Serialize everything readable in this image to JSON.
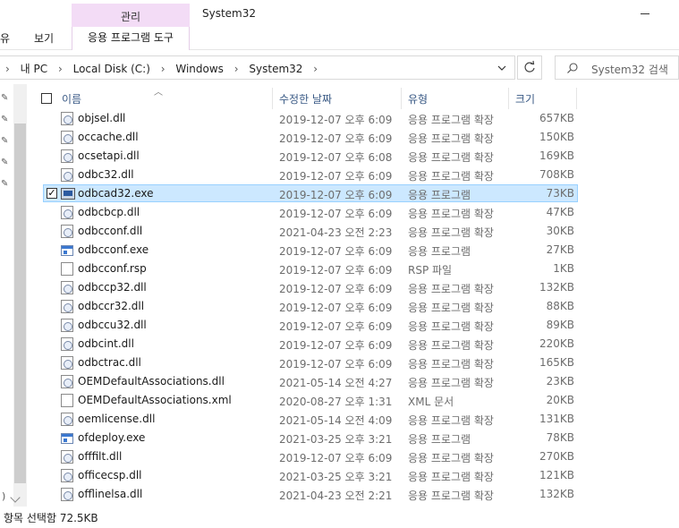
{
  "ribbon": {
    "context_group": "관리",
    "context_tab": "응용 프로그램 도구",
    "tab_partial": "유",
    "tab_view": "보기",
    "window_title": "System32"
  },
  "address": {
    "crumbs": [
      "내 PC",
      "Local Disk (C:)",
      "Windows",
      "System32"
    ],
    "search_placeholder": "System32 검색"
  },
  "columns": {
    "name": "이름",
    "date": "수정한 날짜",
    "type": "유형",
    "size": "크기"
  },
  "files": [
    {
      "name": "objsel.dll",
      "date": "2019-12-07 오후 6:09",
      "type": "응용 프로그램 확장",
      "size": "657KB",
      "icon": "dll-icon"
    },
    {
      "name": "occache.dll",
      "date": "2019-12-07 오후 6:09",
      "type": "응용 프로그램 확장",
      "size": "150KB",
      "icon": "dll-icon"
    },
    {
      "name": "ocsetapi.dll",
      "date": "2019-12-07 오후 6:08",
      "type": "응용 프로그램 확장",
      "size": "169KB",
      "icon": "dll-icon"
    },
    {
      "name": "odbc32.dll",
      "date": "2019-12-07 오후 6:09",
      "type": "응용 프로그램 확장",
      "size": "708KB",
      "icon": "dll-icon"
    },
    {
      "name": "odbcad32.exe",
      "date": "2019-12-07 오후 6:09",
      "type": "응용 프로그램",
      "size": "73KB",
      "icon": "odbc-admin-icon",
      "selected": true
    },
    {
      "name": "odbcbcp.dll",
      "date": "2019-12-07 오후 6:09",
      "type": "응용 프로그램 확장",
      "size": "47KB",
      "icon": "dll-icon"
    },
    {
      "name": "odbcconf.dll",
      "date": "2021-04-23 오전 2:23",
      "type": "응용 프로그램 확장",
      "size": "30KB",
      "icon": "dll-icon"
    },
    {
      "name": "odbcconf.exe",
      "date": "2019-12-07 오후 6:09",
      "type": "응용 프로그램",
      "size": "27KB",
      "icon": "exe-icon"
    },
    {
      "name": "odbcconf.rsp",
      "date": "2019-12-07 오후 6:09",
      "type": "RSP 파일",
      "size": "1KB",
      "icon": "document-icon"
    },
    {
      "name": "odbccp32.dll",
      "date": "2019-12-07 오후 6:09",
      "type": "응용 프로그램 확장",
      "size": "132KB",
      "icon": "dll-icon"
    },
    {
      "name": "odbccr32.dll",
      "date": "2019-12-07 오후 6:09",
      "type": "응용 프로그램 확장",
      "size": "88KB",
      "icon": "dll-icon"
    },
    {
      "name": "odbccu32.dll",
      "date": "2019-12-07 오후 6:09",
      "type": "응용 프로그램 확장",
      "size": "89KB",
      "icon": "dll-icon"
    },
    {
      "name": "odbcint.dll",
      "date": "2019-12-07 오후 6:09",
      "type": "응용 프로그램 확장",
      "size": "220KB",
      "icon": "dll-icon"
    },
    {
      "name": "odbctrac.dll",
      "date": "2019-12-07 오후 6:09",
      "type": "응용 프로그램 확장",
      "size": "165KB",
      "icon": "dll-icon"
    },
    {
      "name": "OEMDefaultAssociations.dll",
      "date": "2021-05-14 오전 4:27",
      "type": "응용 프로그램 확장",
      "size": "23KB",
      "icon": "dll-icon"
    },
    {
      "name": "OEMDefaultAssociations.xml",
      "date": "2020-08-27 오후 1:31",
      "type": "XML 문서",
      "size": "20KB",
      "icon": "document-icon"
    },
    {
      "name": "oemlicense.dll",
      "date": "2021-05-14 오전 4:09",
      "type": "응용 프로그램 확장",
      "size": "131KB",
      "icon": "dll-icon"
    },
    {
      "name": "ofdeploy.exe",
      "date": "2021-03-25 오후 3:21",
      "type": "응용 프로그램",
      "size": "78KB",
      "icon": "exe-icon"
    },
    {
      "name": "offfilt.dll",
      "date": "2019-12-07 오후 6:09",
      "type": "응용 프로그램 확장",
      "size": "270KB",
      "icon": "dll-icon"
    },
    {
      "name": "officecsp.dll",
      "date": "2021-03-25 오후 3:21",
      "type": "응용 프로그램 확장",
      "size": "121KB",
      "icon": "dll-icon"
    },
    {
      "name": "offlinelsa.dll",
      "date": "2021-04-23 오전 2:21",
      "type": "응용 프로그램 확장",
      "size": "132KB",
      "icon": "dll-icon"
    }
  ],
  "status": {
    "text": "항목 선택함 72.5KB"
  },
  "colors": {
    "selection_bg": "#cce8ff",
    "selection_border": "#99d1ff",
    "context_group_bg": "#f3dcf6",
    "header_text": "#3b5b86"
  }
}
